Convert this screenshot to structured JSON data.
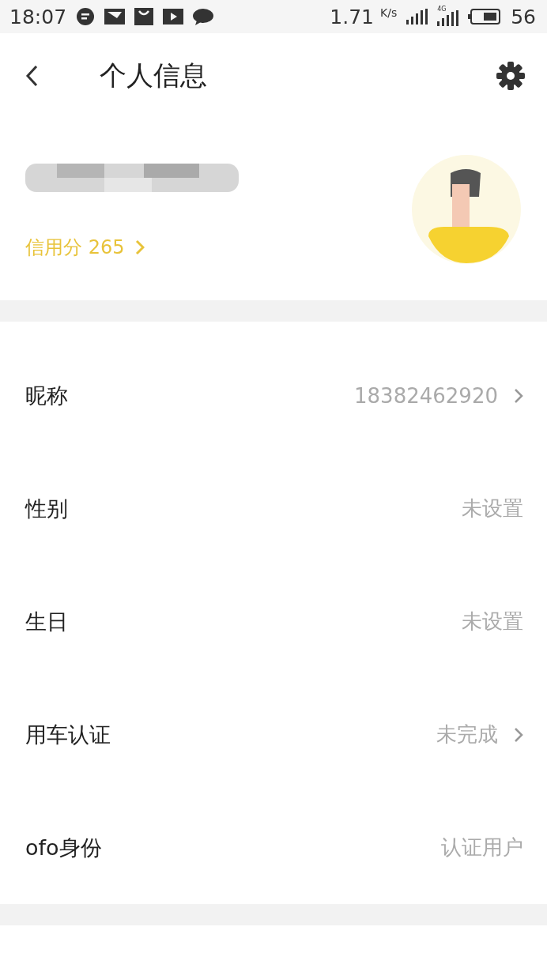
{
  "status_bar": {
    "time": "18:07",
    "speed": "1.71",
    "speed_unit": "K/s",
    "network": "4G",
    "battery": "56"
  },
  "header": {
    "title": "个人信息"
  },
  "profile": {
    "credit_label": "信用分 265"
  },
  "rows": [
    {
      "label": "昵称",
      "value": "18382462920",
      "chevron": true
    },
    {
      "label": "性别",
      "value": "未设置",
      "chevron": false
    },
    {
      "label": "生日",
      "value": "未设置",
      "chevron": false
    },
    {
      "label": "用车认证",
      "value": "未完成",
      "chevron": true
    },
    {
      "label": "ofo身份",
      "value": "认证用户",
      "chevron": false
    }
  ]
}
